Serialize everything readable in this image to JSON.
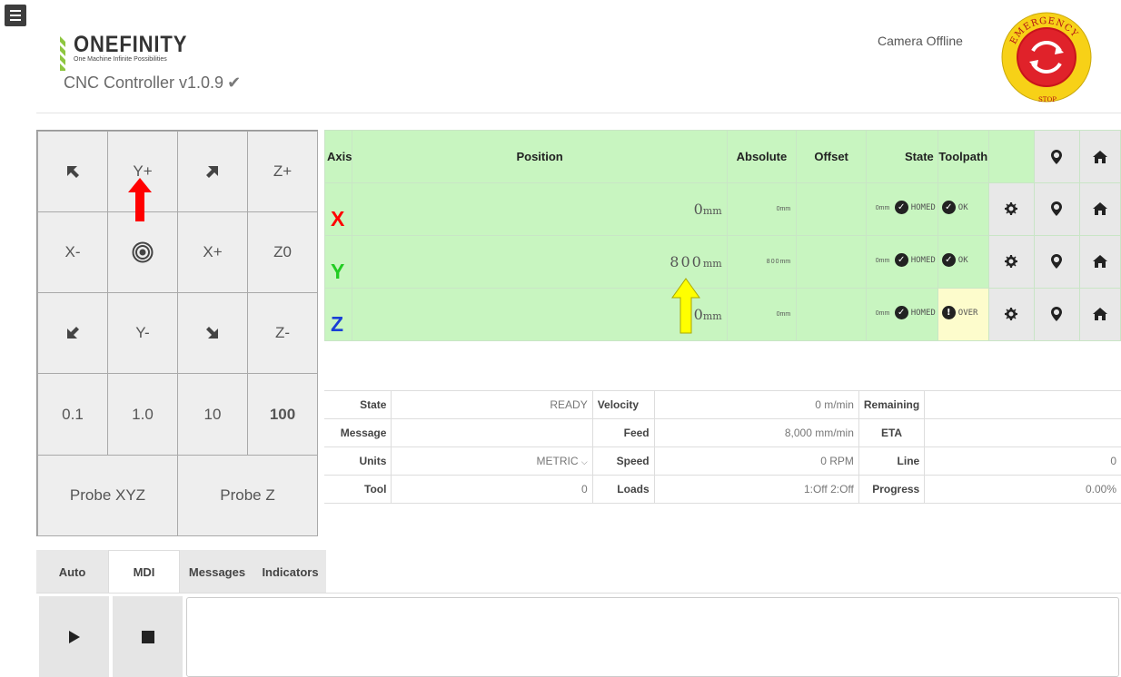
{
  "header": {
    "brand": "ONEFINITY",
    "tagline": "One Machine Infinite Possibilities",
    "title": "CNC Controller v1.0.9",
    "camera_status": "Camera Offline",
    "estop_top": "EMERGENCY",
    "estop_bottom": "STOP"
  },
  "jog": {
    "y_plus": "Y+",
    "z_plus": "Z+",
    "x_minus": "X-",
    "x_plus": "X+",
    "z_zero": "Z0",
    "y_minus": "Y-",
    "z_minus": "Z-",
    "step_01": "0.1",
    "step_1": "1.0",
    "step_10": "10",
    "step_100": "100",
    "probe_xyz": "Probe XYZ",
    "probe_z": "Probe Z"
  },
  "axis_table": {
    "headers": {
      "axis": "Axis",
      "position": "Position",
      "absolute": "Absolute",
      "offset": "Offset",
      "state": "State",
      "toolpath": "Toolpath"
    },
    "rows": [
      {
        "axis": "X",
        "color": "#ff0000",
        "position": "0",
        "unit": "mm",
        "absolute": "0",
        "offset": "0",
        "state": "HOMED",
        "toolpath": "OK"
      },
      {
        "axis": "Y",
        "color": "#22cc22",
        "position": "800",
        "unit": "mm",
        "absolute": "800",
        "offset": "0",
        "state": "HOMED",
        "toolpath": "OK"
      },
      {
        "axis": "Z",
        "color": "#1a3fd6",
        "position": "0",
        "unit": "mm",
        "absolute": "0",
        "offset": "0",
        "state": "HOMED",
        "toolpath": "OVER"
      }
    ],
    "small_unit": "mm"
  },
  "status": {
    "state_label": "State",
    "state_value": "READY",
    "velocity_label": "Velocity",
    "velocity_value": "0 m/min",
    "remaining_label": "Remaining",
    "remaining_value": "",
    "message_label": "Message",
    "message_value": "",
    "feed_label": "Feed",
    "feed_value": "8,000 mm/min",
    "eta_label": "ETA",
    "eta_value": "",
    "units_label": "Units",
    "units_value": "METRIC",
    "speed_label": "Speed",
    "speed_value": "0 RPM",
    "line_label": "Line",
    "line_value": "0",
    "tool_label": "Tool",
    "tool_value": "0",
    "loads_label": "Loads",
    "loads_value": "1:Off 2:Off",
    "progress_label": "Progress",
    "progress_value": "0.00%"
  },
  "tabs": [
    "Auto",
    "MDI",
    "Messages",
    "Indicators"
  ],
  "active_tab": "MDI",
  "colors": {
    "axis_bg": "#c8f5c0",
    "warn_bg": "#fdfccc",
    "annotation_red": "#ff0000",
    "annotation_yellow": "#ffff00"
  }
}
